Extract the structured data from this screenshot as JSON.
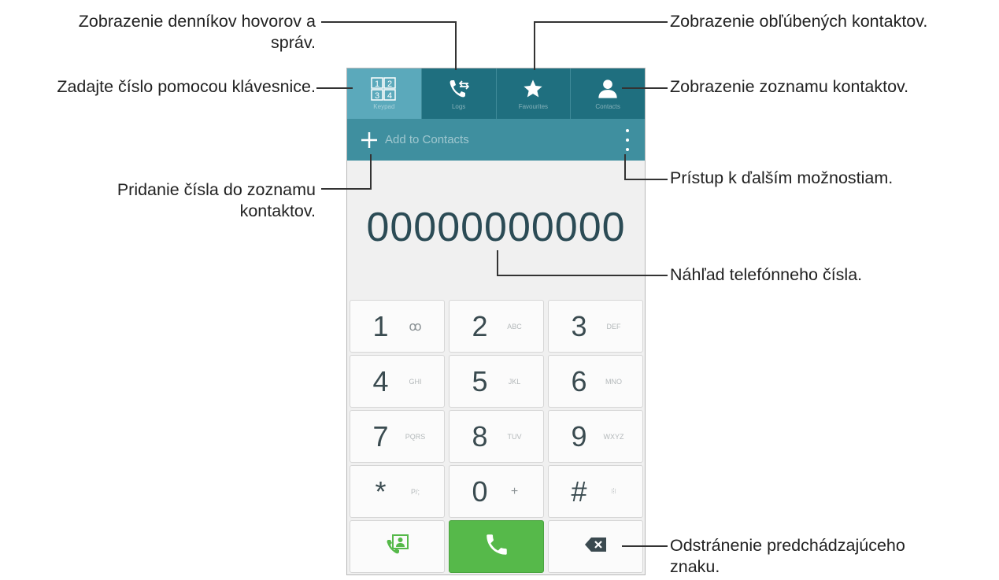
{
  "tabs": [
    {
      "id": "keypad",
      "label": "Keypad",
      "icon": "keypad-icon",
      "active": true
    },
    {
      "id": "logs",
      "label": "Logs",
      "icon": "call-log-icon",
      "active": false
    },
    {
      "id": "favourites",
      "label": "Favourites",
      "icon": "star-icon",
      "active": false
    },
    {
      "id": "contacts",
      "label": "Contacts",
      "icon": "person-icon",
      "active": false
    }
  ],
  "keypad_icon_digits": [
    "1",
    "2",
    "3",
    "4"
  ],
  "action_bar": {
    "add_label": "Add to Contacts",
    "add_icon": "plus-icon",
    "more_icon": "more-vertical-icon"
  },
  "phone_number": "00000000000",
  "keys": [
    {
      "digit": "1",
      "sub": "ꝏ"
    },
    {
      "digit": "2",
      "sub": "ABC"
    },
    {
      "digit": "3",
      "sub": "DEF"
    },
    {
      "digit": "4",
      "sub": "GHI"
    },
    {
      "digit": "5",
      "sub": "JKL"
    },
    {
      "digit": "6",
      "sub": "MNO"
    },
    {
      "digit": "7",
      "sub": "PQRS"
    },
    {
      "digit": "8",
      "sub": "TUV"
    },
    {
      "digit": "9",
      "sub": "WXYZ"
    },
    {
      "digit": "*",
      "sub": "P/;"
    },
    {
      "digit": "0",
      "sub": "+"
    },
    {
      "digit": "#",
      "sub": "⧘⦙⧙"
    }
  ],
  "bottom_buttons": [
    {
      "id": "contact-call",
      "icon": "contact-call-icon"
    },
    {
      "id": "call",
      "icon": "phone-icon"
    },
    {
      "id": "backspace",
      "icon": "backspace-icon"
    }
  ],
  "annotations": {
    "logs_line1": "Zobrazenie denníkov hovorov a",
    "logs_line2": "správ.",
    "keypad": "Zadajte číslo pomocou klávesnice.",
    "add_line1": "Pridanie čísla do zoznamu",
    "add_line2": "kontaktov.",
    "favourites": "Zobrazenie obľúbených kontaktov.",
    "contacts": "Zobrazenie zoznamu kontaktov.",
    "more": "Prístup k ďalším možnostiam.",
    "preview": "Náhľad telefónneho čísla.",
    "delete_line1": "Odstránenie predchádzajúceho",
    "delete_line2": "znaku."
  },
  "colors": {
    "tab_bar": "#1f6f7f",
    "tab_active": "#5ba9bb",
    "action_bar": "#3f8f9f",
    "call_green": "#56b94a"
  }
}
